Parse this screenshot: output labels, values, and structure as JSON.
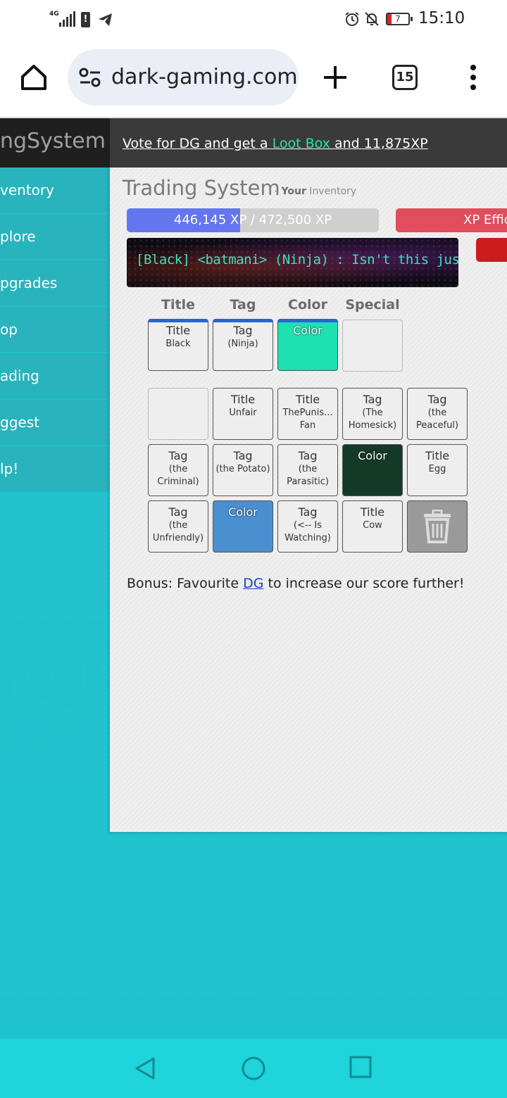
{
  "status_bar": {
    "network": "4G",
    "time": "15:10",
    "battery": "7",
    "icons": [
      "signal-icon",
      "alert-icon",
      "telegram-icon",
      "alarm-icon",
      "mute-icon",
      "battery-icon"
    ]
  },
  "browser": {
    "url": "dark-gaming.com",
    "tab_count": "15"
  },
  "site": {
    "logo": "ngSystem",
    "vote": {
      "prefix": "Vote for DG and get a ",
      "loot": "Loot Box",
      "suffix": " and 11,875XP"
    }
  },
  "sidebar": {
    "items": [
      {
        "label": "ventory"
      },
      {
        "label": "plore"
      },
      {
        "label": "pgrades"
      },
      {
        "label": "op"
      },
      {
        "label": "ading"
      },
      {
        "label": "ggest"
      },
      {
        "label": "lp!"
      }
    ]
  },
  "page": {
    "title": "Trading System",
    "sub_prefix": "- ",
    "sub_bold": "Your",
    "sub_rest": " Inventory"
  },
  "xp": {
    "text": "446,145 XP / 472,500 XP",
    "current": 446145,
    "max": 472500,
    "fill_fraction": 0.45,
    "efficiency_label": "XP Effic"
  },
  "chat_preview": "[Black] <batmani> (Ninja) : Isn't this just the best?",
  "equipped": {
    "headers": [
      "Title",
      "Tag",
      "Color",
      "Special"
    ],
    "slots": [
      {
        "type": "Title",
        "value": "Black",
        "color": null
      },
      {
        "type": "Tag",
        "value": "(Ninja)",
        "color": null
      },
      {
        "type": "Color",
        "value": "",
        "color": "#1ee0b0"
      },
      {
        "type": "",
        "value": "",
        "color": null
      }
    ]
  },
  "inventory": [
    {
      "type": "",
      "value": "",
      "color": null
    },
    {
      "type": "Title",
      "value": "Unfair",
      "color": null
    },
    {
      "type": "Title",
      "value": "ThePunis... Fan",
      "color": null
    },
    {
      "type": "Tag",
      "value": "(The Homesick)",
      "color": null
    },
    {
      "type": "Tag",
      "value": "(the Peaceful)",
      "color": null
    },
    {
      "type": "Tag",
      "value": "(the Criminal)",
      "color": null
    },
    {
      "type": "Tag",
      "value": "(the Potato)",
      "color": null
    },
    {
      "type": "Tag",
      "value": "(the Parasitic)",
      "color": null
    },
    {
      "type": "Color",
      "value": "",
      "color": "#143a27"
    },
    {
      "type": "Title",
      "value": "Egg",
      "color": null
    },
    {
      "type": "Tag",
      "value": "(the Unfriendly)",
      "color": null
    },
    {
      "type": "Color",
      "value": "",
      "color": "#4a8fd0"
    },
    {
      "type": "Tag",
      "value": "(<-- Is Watching)",
      "color": null
    },
    {
      "type": "Title",
      "value": "Cow",
      "color": null
    },
    {
      "type": "trash",
      "value": "",
      "color": null
    }
  ],
  "bonus": {
    "prefix": "Bonus: Favourite ",
    "link": "DG",
    "suffix": " to increase our score further!"
  },
  "nav": [
    "back-icon",
    "home-circle-icon",
    "recents-icon"
  ]
}
